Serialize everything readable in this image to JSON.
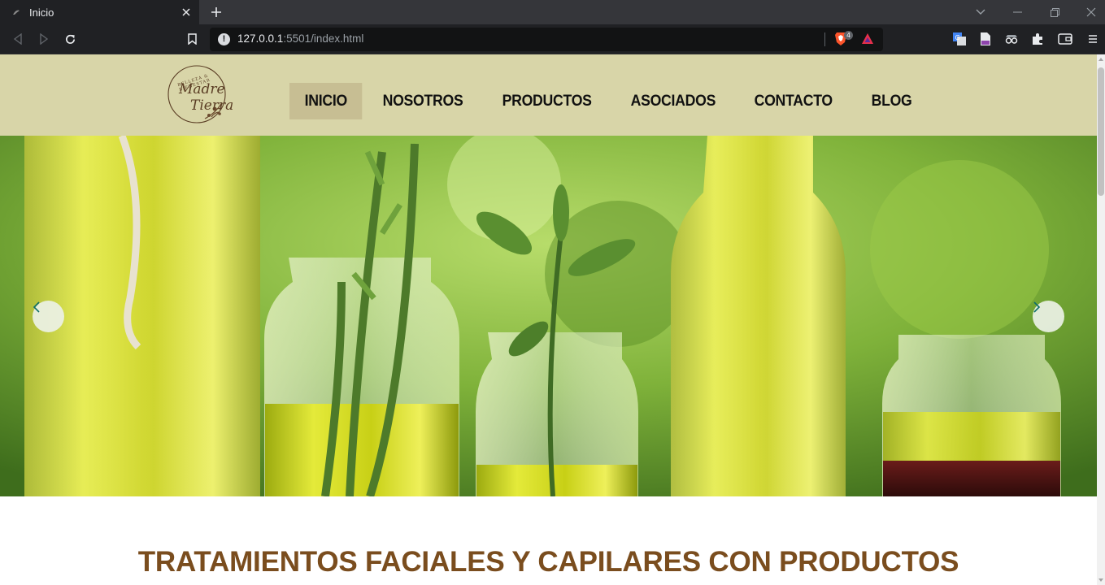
{
  "browser": {
    "tab": {
      "title": "Inicio"
    },
    "url": {
      "host": "127.0.0.1",
      "rest": ":5501/index.html"
    },
    "shields_count": "4"
  },
  "site": {
    "logo": {
      "text_line1": "Madre",
      "text_line2": "Tierra",
      "tagline": "BELLEZA & BIENESTAR"
    },
    "nav": [
      {
        "label": "INICIO",
        "active": true
      },
      {
        "label": "NOSOTROS",
        "active": false
      },
      {
        "label": "PRODUCTOS",
        "active": false
      },
      {
        "label": "ASOCIADOS",
        "active": false
      },
      {
        "label": "CONTACTO",
        "active": false
      },
      {
        "label": "BLOG",
        "active": false
      }
    ],
    "hero": {
      "prev_icon": "chevron-left-icon",
      "next_icon": "chevron-right-icon"
    },
    "section_title": "TRATAMIENTOS FACIALES Y CAPILARES CON PRODUCTOS"
  },
  "colors": {
    "header_bg": "#d8d5a8",
    "nav_active_bg": "#c7be93",
    "title_color": "#7a4d1e",
    "carousel_arrow": "#0e6e6a"
  }
}
